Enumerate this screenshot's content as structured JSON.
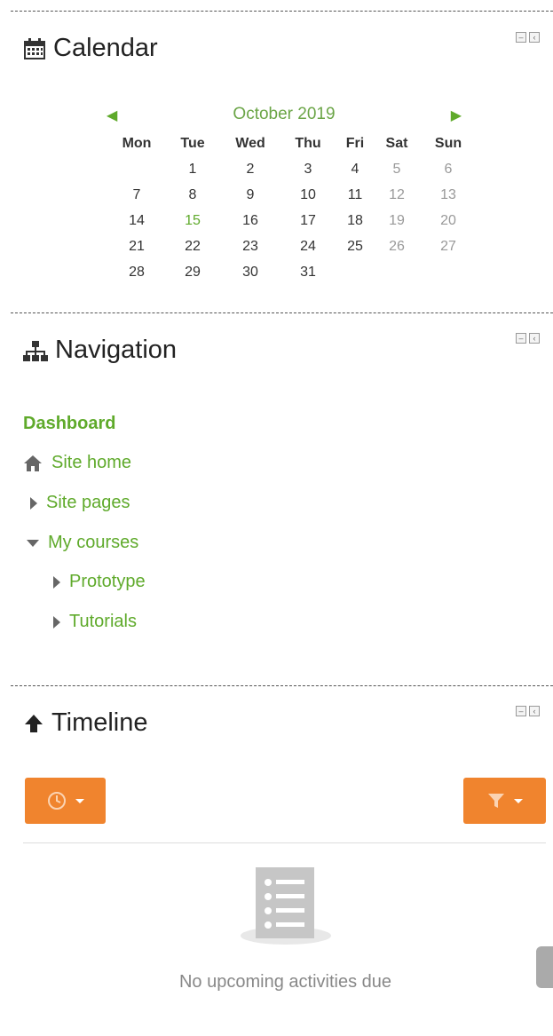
{
  "calendar": {
    "title": "Calendar",
    "month": "October 2019",
    "weekdays": [
      "Mon",
      "Tue",
      "Wed",
      "Thu",
      "Fri",
      "Sat",
      "Sun"
    ],
    "weeks": [
      [
        "",
        "1",
        "2",
        "3",
        "4",
        "5",
        "6"
      ],
      [
        "7",
        "8",
        "9",
        "10",
        "11",
        "12",
        "13"
      ],
      [
        "14",
        "15",
        "16",
        "17",
        "18",
        "19",
        "20"
      ],
      [
        "21",
        "22",
        "23",
        "24",
        "25",
        "26",
        "27"
      ],
      [
        "28",
        "29",
        "30",
        "31",
        "",
        "",
        ""
      ]
    ],
    "today": "15"
  },
  "navigation": {
    "title": "Navigation",
    "dashboard": "Dashboard",
    "site_home": "Site home",
    "site_pages": "Site pages",
    "my_courses": "My courses",
    "prototype": "Prototype",
    "tutorials": "Tutorials"
  },
  "timeline": {
    "title": "Timeline",
    "empty": "No upcoming activities due"
  },
  "colors": {
    "accent_green": "#5faa2b",
    "button_orange": "#f0842e"
  }
}
